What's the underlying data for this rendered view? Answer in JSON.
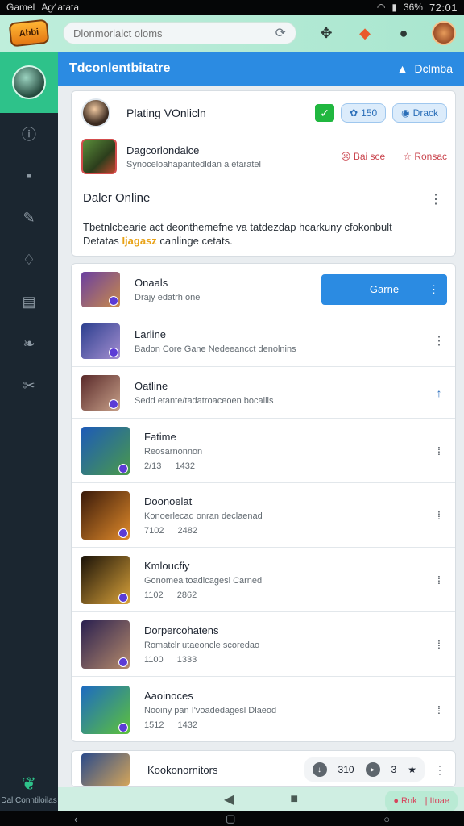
{
  "statusbar": {
    "carrier": "Gamel",
    "carrier_sub": "Ag⁄ atata",
    "battery": "36%",
    "time": "72:01"
  },
  "topbar": {
    "logo_text": "Abbi",
    "search_placeholder": "Dlonmorlalct oloms"
  },
  "sidebar": {
    "bottom_label": "Dal Conntiloilas"
  },
  "header": {
    "title": "Tdconlentbitatre",
    "right_label": "Dclmba"
  },
  "card1": {
    "player_name": "Plating VOnlicln",
    "pill1": "150",
    "pill2": "Drack",
    "game_title": "Dagcorlondalce",
    "game_sub": "Synoceloahaparitedldan a etaratel",
    "act1": "Bai sce",
    "act2": "Ronsac",
    "status_title": "Daler Online",
    "status_desc_1": "Tbetnlcbearie act deonthemefne va tatdezdap hcarkuny cfokonbult",
    "status_desc_2": "Detatas",
    "status_highlight": "Ijagasz",
    "status_desc_3": "canlinge cetats."
  },
  "list": [
    {
      "title": "Onaals",
      "sub": "Drajy edatrh one",
      "extra": ""
    },
    {
      "title": "Larline",
      "sub": "Badon Core Gane Nedeeancct denolnins",
      "extra": ""
    },
    {
      "title": "Oatline",
      "sub": "Sedd etante/tadatroaceoen bocallis",
      "extra": ""
    },
    {
      "title": "Fatime",
      "sub": "Reosarnonnon",
      "extra": "2/13  1432"
    },
    {
      "title": "Doonoelat",
      "sub": "Konoerlecad onran declaenad",
      "extra": "7102  2482"
    },
    {
      "title": "Kmloucfiy",
      "sub": "Gonomea toadicagesl Carned",
      "extra": "1102  2862"
    },
    {
      "title": "Dorpercohatens",
      "sub": "Romatclr utaeoncle scoredao",
      "extra": "1100  1333"
    },
    {
      "title": "Aaoinoces",
      "sub": "Nooiny pan I'voadedagesl Dlaeod",
      "extra": "1512  1432"
    }
  ],
  "game_button": "Garne",
  "card3": {
    "name": "Kookonornitors",
    "c1": "310",
    "c2": "3"
  },
  "fab": {
    "left": "Rnk",
    "right": "Itoae"
  },
  "colors": {
    "accent": "#2b8be2",
    "sidebar": "#1b2630",
    "green": "#2ec28a"
  }
}
